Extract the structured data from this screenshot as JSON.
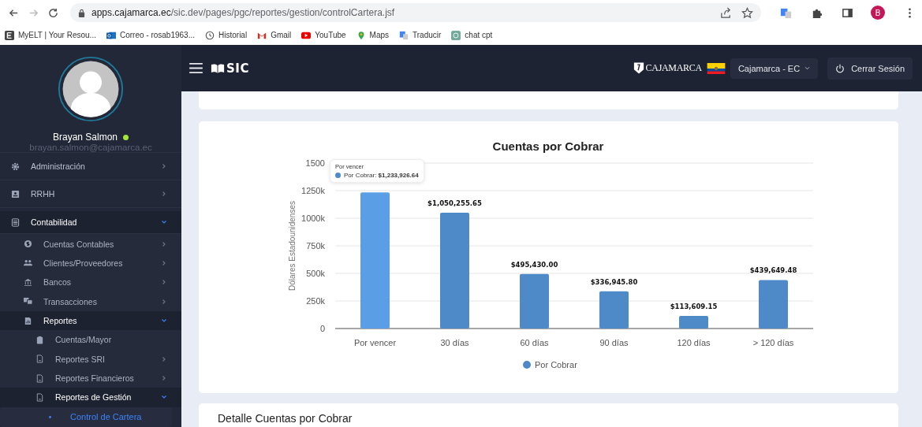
{
  "browser": {
    "url": {
      "host": "apps.cajamarca.ec",
      "path": "/sic.dev/pages/pgc/reportes/gestion/controlCartera.jsf"
    },
    "forward_disabled": true,
    "profile_initial": "B",
    "bookmarks": [
      {
        "label": "MyELT | Your Resou..."
      },
      {
        "label": "Correo - rosab1963..."
      },
      {
        "label": "Historial"
      },
      {
        "label": "Gmail"
      },
      {
        "label": "YouTube"
      },
      {
        "label": "Maps"
      },
      {
        "label": "Traducir"
      },
      {
        "label": "chat cpt"
      }
    ]
  },
  "user": {
    "name": "Brayan Salmon",
    "email": "brayan.salmon@cajamarca.ec",
    "online": true
  },
  "sidebar": {
    "items": [
      {
        "label": "Administración",
        "expanded": false
      },
      {
        "label": "RRHH",
        "expanded": false
      },
      {
        "label": "Contabilidad",
        "expanded": true,
        "children": [
          {
            "label": "Cuentas Contables",
            "expanded": false
          },
          {
            "label": "Clientes/Proveedores",
            "expanded": false
          },
          {
            "label": "Bancos",
            "expanded": false
          },
          {
            "label": "Transacciones",
            "expanded": false
          },
          {
            "label": "Reportes",
            "expanded": true,
            "children": [
              {
                "label": "Cuentas/Mayor"
              },
              {
                "label": "Reportes SRI",
                "expanded": false
              },
              {
                "label": "Reportes Financieros",
                "expanded": false
              },
              {
                "label": "Reportes de Gestión",
                "expanded": true,
                "children": [
                  {
                    "label": "Control de Cartera",
                    "selected": true
                  }
                ]
              }
            ]
          }
        ]
      }
    ]
  },
  "header": {
    "app_name": "SIC",
    "brand": "CAJAMARCA",
    "company_select": "Cajamarca - EC",
    "logout": "Cerrar Sesión"
  },
  "chart_card": {
    "chart_data": {
      "type": "bar",
      "title": "Cuentas por Cobrar",
      "ylabel": "Dólares Estadounidenses",
      "categories": [
        "Por vencer",
        "30 días",
        "60 días",
        "90 días",
        "120 días",
        "> 120 días"
      ],
      "series": [
        {
          "name": "Por Cobrar",
          "color": "#4e8ac8",
          "values": [
            1233.9,
            1050.3,
            495.4,
            336.9,
            113.6,
            439.6
          ]
        }
      ],
      "ylim": [
        0,
        1500
      ],
      "yticks": [
        0,
        {
          "value": 250,
          "label": "250k"
        },
        {
          "value": 500,
          "label": "500k"
        },
        {
          "value": 750,
          "label": "750k"
        },
        {
          "value": 1000,
          "label": "1000k"
        },
        {
          "value": 1250,
          "label": "1250k"
        },
        1500
      ],
      "grid": true,
      "value_labels": [
        null,
        "$1,050,255.65",
        "$495,430.00",
        "$336,945.80",
        "$113,609.15",
        "$439,649.48"
      ]
    },
    "hovered_bars": [
      true,
      false,
      false,
      false,
      false,
      false
    ],
    "tooltip": {
      "title": "Por vencer",
      "text": "Por Cobrar: **$1,233,926.64**"
    }
  },
  "detail_card": {
    "title": "Detalle Cuentas por Cobrar"
  }
}
